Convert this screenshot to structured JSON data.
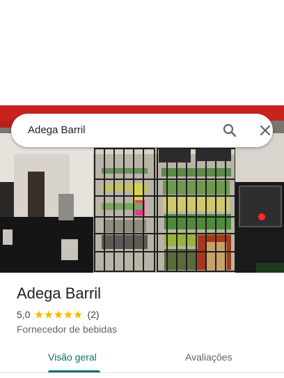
{
  "search": {
    "query": "Adega Barril",
    "search_icon": "search-icon",
    "close_icon": "close-icon"
  },
  "photo": {
    "description_icon": "storefront-photo"
  },
  "place": {
    "title": "Adega Barril",
    "rating": "5,0",
    "stars": 5,
    "review_count": "(2)",
    "category": "Fornecedor de bebidas",
    "star_color": "#fbbc04"
  },
  "tabs": [
    {
      "label": "Visão geral",
      "active": true
    },
    {
      "label": "Avaliações",
      "active": false
    }
  ],
  "colors": {
    "accent": "#0b6e72",
    "awning_red": "#c8231f"
  }
}
